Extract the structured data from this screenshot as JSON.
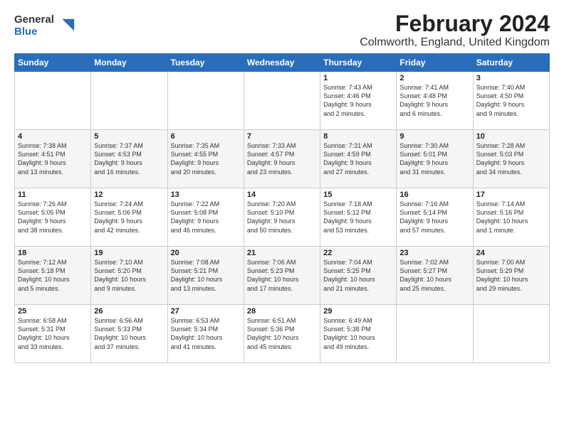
{
  "logo": {
    "general": "General",
    "blue": "Blue"
  },
  "title": "February 2024",
  "location": "Colmworth, England, United Kingdom",
  "days_of_week": [
    "Sunday",
    "Monday",
    "Tuesday",
    "Wednesday",
    "Thursday",
    "Friday",
    "Saturday"
  ],
  "weeks": [
    [
      {
        "num": "",
        "info": ""
      },
      {
        "num": "",
        "info": ""
      },
      {
        "num": "",
        "info": ""
      },
      {
        "num": "",
        "info": ""
      },
      {
        "num": "1",
        "info": "Sunrise: 7:43 AM\nSunset: 4:46 PM\nDaylight: 9 hours\nand 2 minutes."
      },
      {
        "num": "2",
        "info": "Sunrise: 7:41 AM\nSunset: 4:48 PM\nDaylight: 9 hours\nand 6 minutes."
      },
      {
        "num": "3",
        "info": "Sunrise: 7:40 AM\nSunset: 4:50 PM\nDaylight: 9 hours\nand 9 minutes."
      }
    ],
    [
      {
        "num": "4",
        "info": "Sunrise: 7:38 AM\nSunset: 4:51 PM\nDaylight: 9 hours\nand 13 minutes."
      },
      {
        "num": "5",
        "info": "Sunrise: 7:37 AM\nSunset: 4:53 PM\nDaylight: 9 hours\nand 16 minutes."
      },
      {
        "num": "6",
        "info": "Sunrise: 7:35 AM\nSunset: 4:55 PM\nDaylight: 9 hours\nand 20 minutes."
      },
      {
        "num": "7",
        "info": "Sunrise: 7:33 AM\nSunset: 4:57 PM\nDaylight: 9 hours\nand 23 minutes."
      },
      {
        "num": "8",
        "info": "Sunrise: 7:31 AM\nSunset: 4:59 PM\nDaylight: 9 hours\nand 27 minutes."
      },
      {
        "num": "9",
        "info": "Sunrise: 7:30 AM\nSunset: 5:01 PM\nDaylight: 9 hours\nand 31 minutes."
      },
      {
        "num": "10",
        "info": "Sunrise: 7:28 AM\nSunset: 5:03 PM\nDaylight: 9 hours\nand 34 minutes."
      }
    ],
    [
      {
        "num": "11",
        "info": "Sunrise: 7:26 AM\nSunset: 5:05 PM\nDaylight: 9 hours\nand 38 minutes."
      },
      {
        "num": "12",
        "info": "Sunrise: 7:24 AM\nSunset: 5:06 PM\nDaylight: 9 hours\nand 42 minutes."
      },
      {
        "num": "13",
        "info": "Sunrise: 7:22 AM\nSunset: 5:08 PM\nDaylight: 9 hours\nand 46 minutes."
      },
      {
        "num": "14",
        "info": "Sunrise: 7:20 AM\nSunset: 5:10 PM\nDaylight: 9 hours\nand 50 minutes."
      },
      {
        "num": "15",
        "info": "Sunrise: 7:18 AM\nSunset: 5:12 PM\nDaylight: 9 hours\nand 53 minutes."
      },
      {
        "num": "16",
        "info": "Sunrise: 7:16 AM\nSunset: 5:14 PM\nDaylight: 9 hours\nand 57 minutes."
      },
      {
        "num": "17",
        "info": "Sunrise: 7:14 AM\nSunset: 5:16 PM\nDaylight: 10 hours\nand 1 minute."
      }
    ],
    [
      {
        "num": "18",
        "info": "Sunrise: 7:12 AM\nSunset: 5:18 PM\nDaylight: 10 hours\nand 5 minutes."
      },
      {
        "num": "19",
        "info": "Sunrise: 7:10 AM\nSunset: 5:20 PM\nDaylight: 10 hours\nand 9 minutes."
      },
      {
        "num": "20",
        "info": "Sunrise: 7:08 AM\nSunset: 5:21 PM\nDaylight: 10 hours\nand 13 minutes."
      },
      {
        "num": "21",
        "info": "Sunrise: 7:06 AM\nSunset: 5:23 PM\nDaylight: 10 hours\nand 17 minutes."
      },
      {
        "num": "22",
        "info": "Sunrise: 7:04 AM\nSunset: 5:25 PM\nDaylight: 10 hours\nand 21 minutes."
      },
      {
        "num": "23",
        "info": "Sunrise: 7:02 AM\nSunset: 5:27 PM\nDaylight: 10 hours\nand 25 minutes."
      },
      {
        "num": "24",
        "info": "Sunrise: 7:00 AM\nSunset: 5:29 PM\nDaylight: 10 hours\nand 29 minutes."
      }
    ],
    [
      {
        "num": "25",
        "info": "Sunrise: 6:58 AM\nSunset: 5:31 PM\nDaylight: 10 hours\nand 33 minutes."
      },
      {
        "num": "26",
        "info": "Sunrise: 6:56 AM\nSunset: 5:33 PM\nDaylight: 10 hours\nand 37 minutes."
      },
      {
        "num": "27",
        "info": "Sunrise: 6:53 AM\nSunset: 5:34 PM\nDaylight: 10 hours\nand 41 minutes."
      },
      {
        "num": "28",
        "info": "Sunrise: 6:51 AM\nSunset: 5:36 PM\nDaylight: 10 hours\nand 45 minutes."
      },
      {
        "num": "29",
        "info": "Sunrise: 6:49 AM\nSunset: 5:38 PM\nDaylight: 10 hours\nand 49 minutes."
      },
      {
        "num": "",
        "info": ""
      },
      {
        "num": "",
        "info": ""
      }
    ]
  ]
}
